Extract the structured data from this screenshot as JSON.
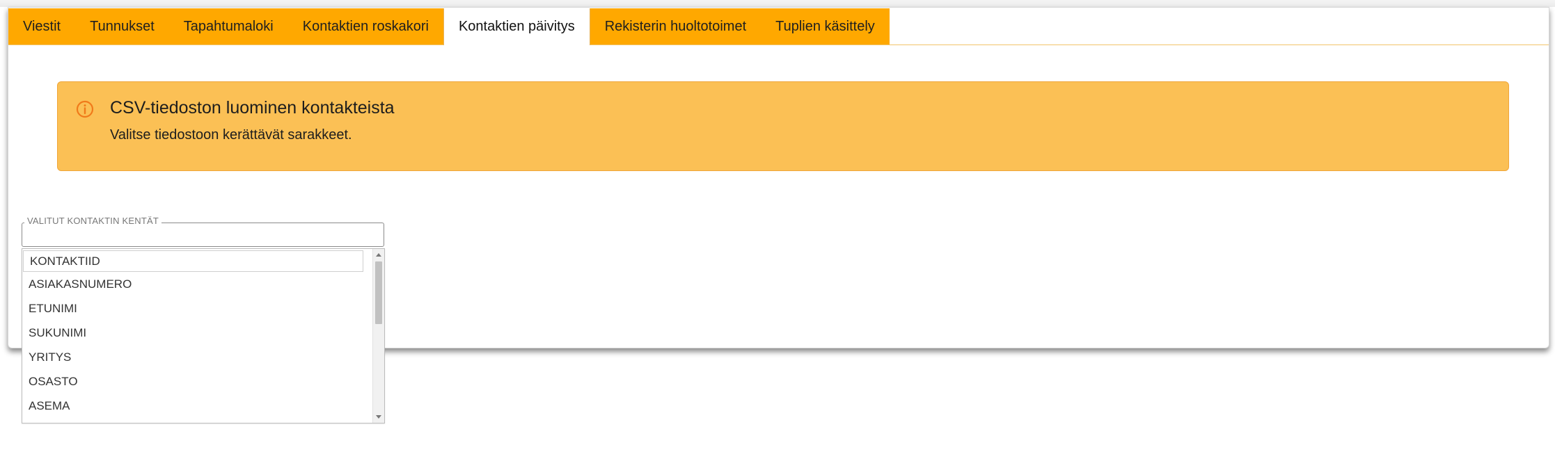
{
  "tabs": [
    {
      "label": "Viestit"
    },
    {
      "label": "Tunnukset"
    },
    {
      "label": "Tapahtumaloki"
    },
    {
      "label": "Kontaktien roskakori"
    },
    {
      "label": "Kontaktien päivitys",
      "active": true
    },
    {
      "label": "Rekisterin huoltotoimet"
    },
    {
      "label": "Tuplien käsittely"
    }
  ],
  "alert": {
    "icon": "info-circle-icon",
    "title": "CSV-tiedoston luominen kontakteista",
    "text": "Valitse tiedostoon kerättävät sarakkeet.",
    "color": "#fbc055",
    "icon_color": "#f07a1a"
  },
  "field": {
    "legend": "VALITUT KONTAKTIN KENTÄT",
    "value": ""
  },
  "options": [
    "KONTAKTIID",
    "ASIAKASNUMERO",
    "ETUNIMI",
    "SUKUNIMI",
    "YRITYS",
    "OSASTO",
    "ASEMA"
  ],
  "colors": {
    "tab_bg": "#ffa800",
    "tab_active_bg": "#ffffff"
  }
}
